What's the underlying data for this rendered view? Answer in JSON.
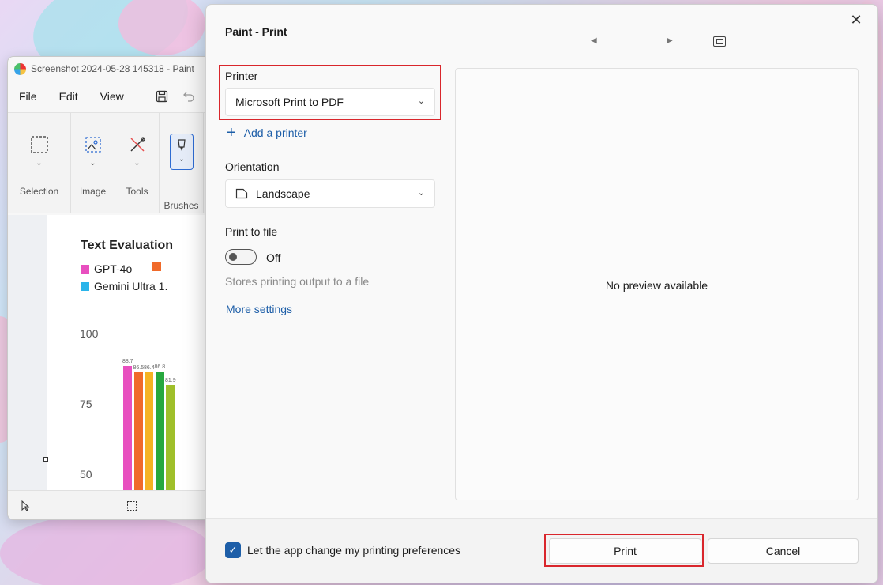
{
  "paint": {
    "title": "Screenshot 2024-05-28 145318 - Paint",
    "menu": [
      "File",
      "Edit",
      "View"
    ],
    "ribbon": [
      "Selection",
      "Image",
      "Tools",
      "Brushes"
    ]
  },
  "canvas_chart": {
    "title": "Text Evaluation",
    "legend": [
      "GPT-4o",
      "Gemini Ultra 1."
    ],
    "yticks": [
      "100",
      "75",
      "50"
    ],
    "bar_labels": [
      "88.7",
      "86.5",
      "86.4",
      "86.8",
      "81.9"
    ],
    "colors": [
      "#e84fbf",
      "#f06a2a",
      "#f5b324",
      "#27a83e",
      "#9fbf2a",
      "#2ab4ea"
    ]
  },
  "dialog": {
    "title": "Paint - Print",
    "printer_label": "Printer",
    "printer_value": "Microsoft Print to PDF",
    "add_printer": "Add a printer",
    "orientation_label": "Orientation",
    "orientation_value": "Landscape",
    "print_to_file_label": "Print to file",
    "print_to_file_state": "Off",
    "print_to_file_hint": "Stores printing output to a file",
    "more_settings": "More settings",
    "preview_text": "No preview available",
    "pref_checkbox_label": "Let the app change my printing preferences",
    "print_button": "Print",
    "cancel_button": "Cancel"
  },
  "accent_color": "#1d5ea8",
  "highlight_color": "#d9262c"
}
